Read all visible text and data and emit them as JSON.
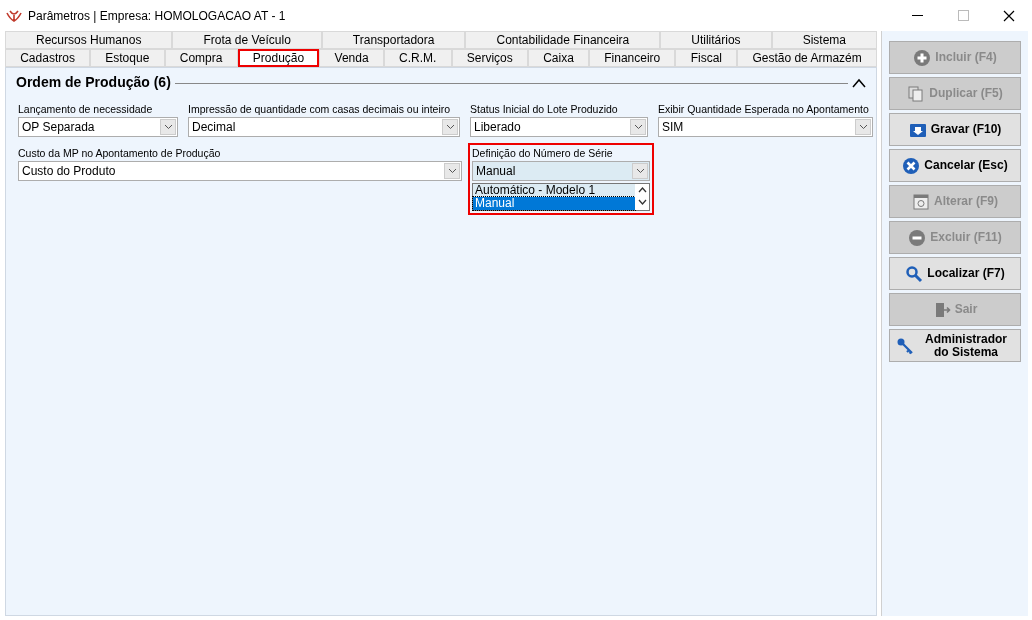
{
  "window": {
    "title": "Parâmetros | Empresa: HOMOLOGACAO AT - 1"
  },
  "tab_rows": [
    [
      {
        "label": "Recursos Humanos",
        "selected": false,
        "highlighted": false
      },
      {
        "label": "Frota de Veículo",
        "selected": false,
        "highlighted": false
      },
      {
        "label": "Transportadora",
        "selected": false,
        "highlighted": false
      },
      {
        "label": "Contabilidade Financeira",
        "selected": false,
        "highlighted": false
      },
      {
        "label": "Utilitários",
        "selected": false,
        "highlighted": false
      },
      {
        "label": "Sistema",
        "selected": false,
        "highlighted": false
      }
    ],
    [
      {
        "label": "Cadastros",
        "selected": false,
        "highlighted": false
      },
      {
        "label": "Estoque",
        "selected": false,
        "highlighted": false
      },
      {
        "label": "Compra",
        "selected": false,
        "highlighted": false
      },
      {
        "label": "Produção",
        "selected": true,
        "highlighted": true
      },
      {
        "label": "Venda",
        "selected": false,
        "highlighted": false
      },
      {
        "label": "C.R.M.",
        "selected": false,
        "highlighted": false
      },
      {
        "label": "Serviços",
        "selected": false,
        "highlighted": false
      },
      {
        "label": "Caixa",
        "selected": false,
        "highlighted": false
      },
      {
        "label": "Financeiro",
        "selected": false,
        "highlighted": false
      },
      {
        "label": "Fiscal",
        "selected": false,
        "highlighted": false
      },
      {
        "label": "Gestão de Armazém",
        "selected": false,
        "highlighted": false
      }
    ]
  ],
  "section": {
    "title": "Ordem de Produção (6)",
    "expanded": true
  },
  "field_rows": [
    [
      {
        "label": "Lançamento de necessidade",
        "value": "OP Separada",
        "highlighted": false
      },
      {
        "label": "Impressão de quantidade com casas decimais ou inteiro",
        "value": "Decimal",
        "highlighted": false
      },
      {
        "label": "Status Inicial do Lote Produzido",
        "value": "Liberado",
        "highlighted": false
      },
      {
        "label": "Exibir Quantidade Esperada no Apontamento",
        "value": "SIM",
        "highlighted": false
      }
    ],
    [
      {
        "label": "Custo da MP no Apontamento de Produção",
        "value": "Custo do Produto",
        "highlighted": false
      },
      {
        "label": "Definição do Número de Série",
        "value": "Manual",
        "highlighted": true,
        "options": [
          {
            "label": "Automático - Modelo 1",
            "selected": false
          },
          {
            "label": "Manual",
            "selected": true
          }
        ]
      }
    ]
  ],
  "buttons": [
    {
      "label": "Incluir (F4)",
      "kind": "plus",
      "disabled": true
    },
    {
      "label": "Duplicar (F5)",
      "kind": "copy",
      "disabled": true
    },
    {
      "label": "Gravar (F10)",
      "kind": "save",
      "disabled": false
    },
    {
      "label": "Cancelar (Esc)",
      "kind": "cancel",
      "disabled": false
    },
    {
      "label": "Alterar (F9)",
      "kind": "edit",
      "disabled": true
    },
    {
      "label": "Excluir (F11)",
      "kind": "minus",
      "disabled": true
    },
    {
      "label": "Localizar (F7)",
      "kind": "search",
      "disabled": false
    },
    {
      "label": "Sair",
      "kind": "exit",
      "disabled": true
    },
    {
      "label": "Administrador do Sistema",
      "kind": "key",
      "disabled": false
    }
  ]
}
